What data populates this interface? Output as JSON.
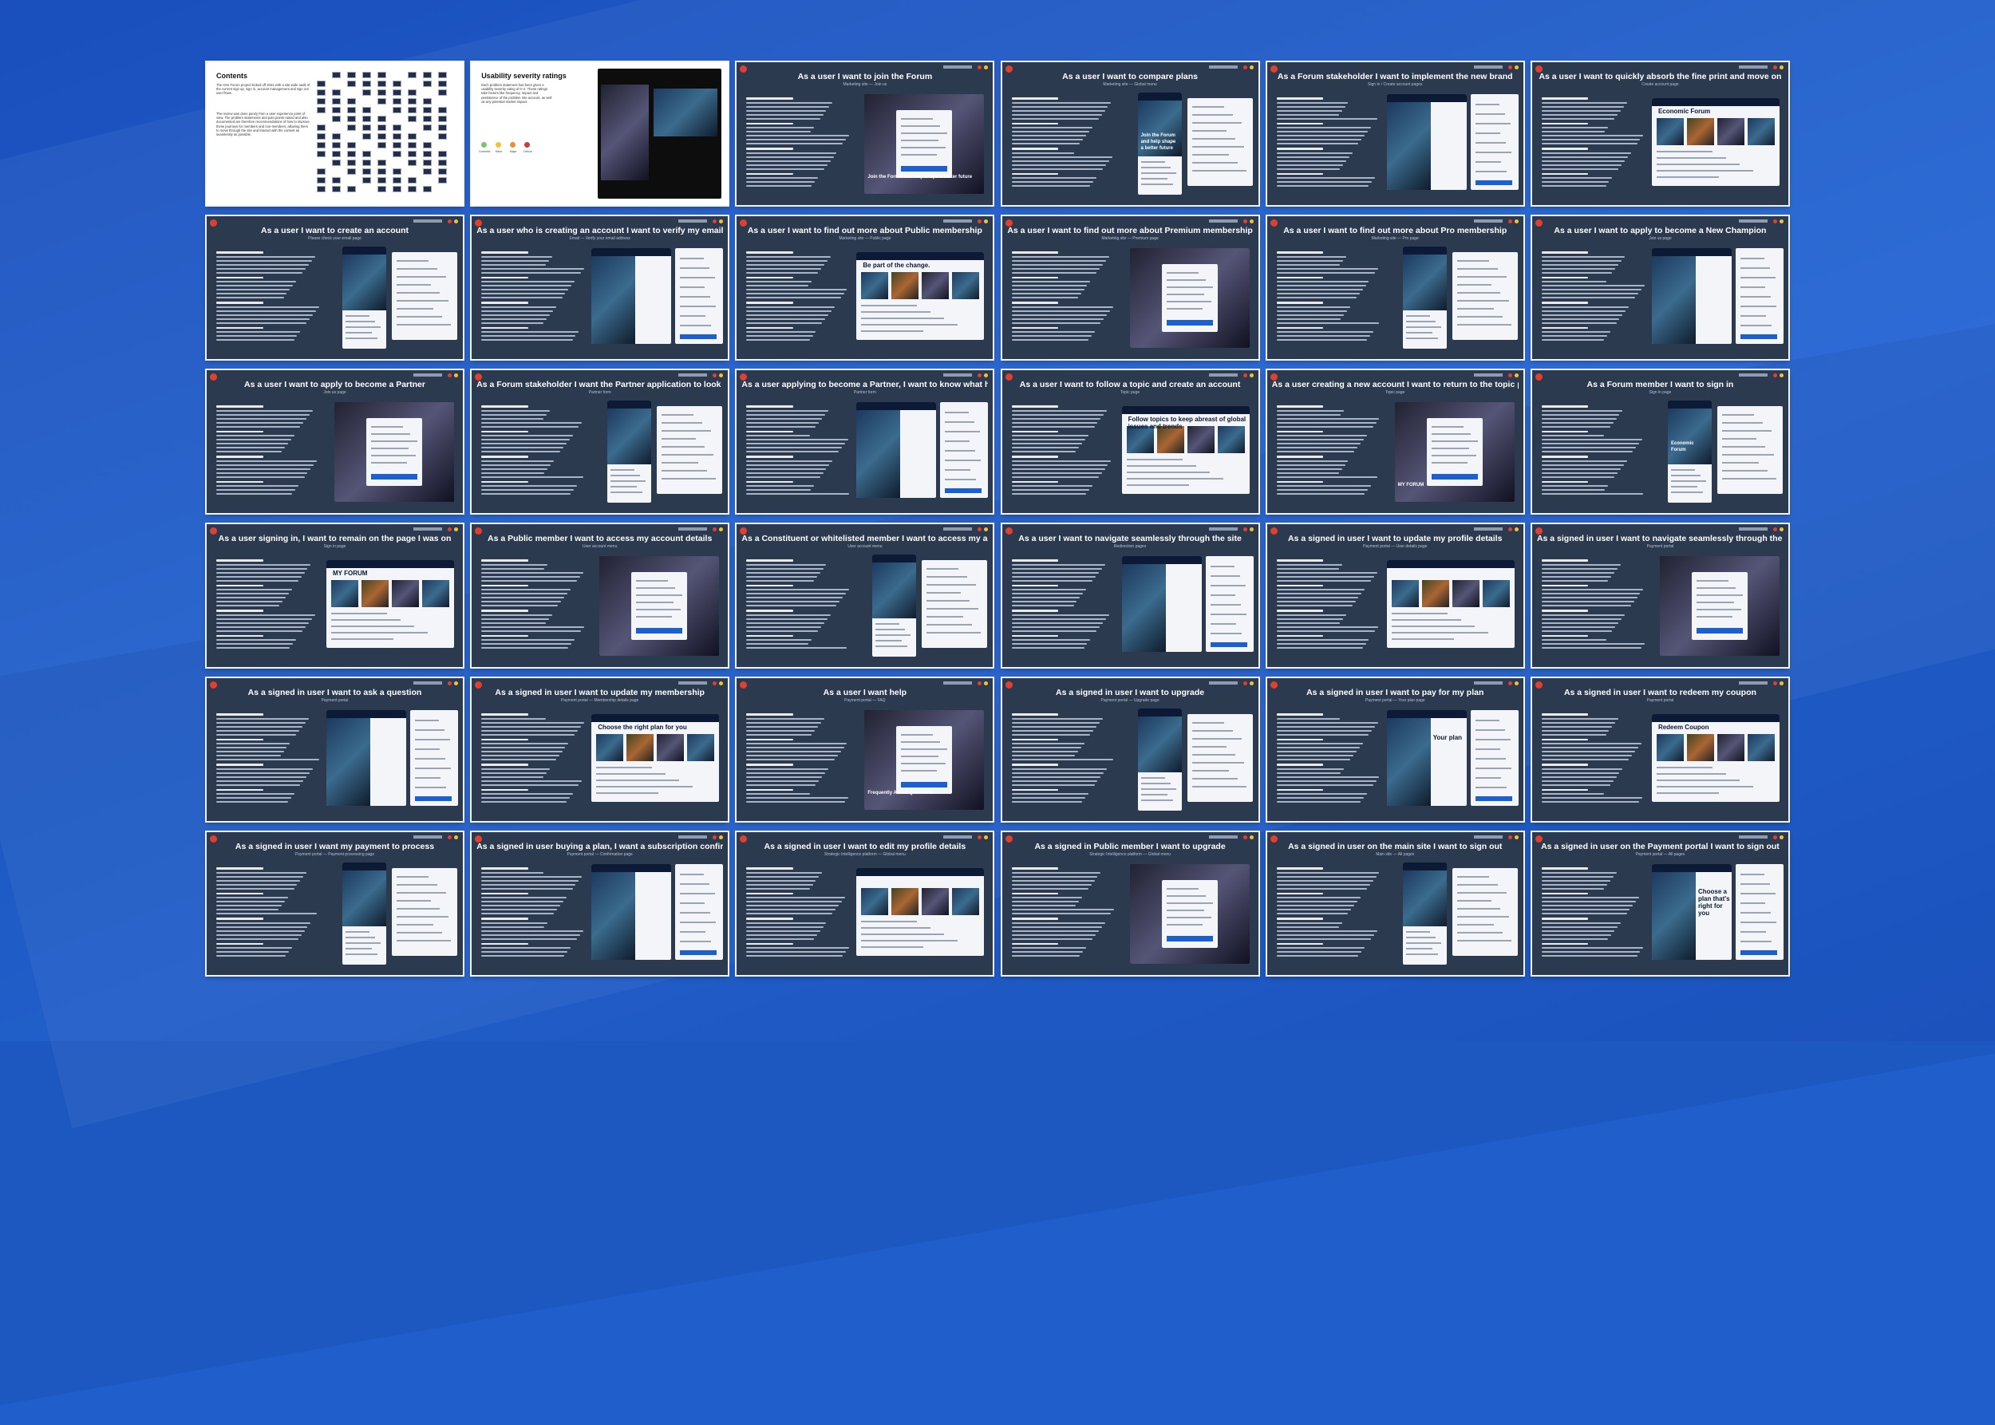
{
  "slides": [
    {
      "title": "Contents",
      "kind": "contents",
      "body": "The One Forum project kicked off 2022 with a site-wide audit of the current sign up, sign in, account management and sign out user flows.",
      "body2": "The review was done purely from a user experience point of view. The problem statements and pain points raised and also documented are therefore recommendations of how to improve these journeys for members and non-members, allowing them to move through the site and interact with the content as seamlessly as possible."
    },
    {
      "title": "Usability severity ratings",
      "kind": "severity",
      "body": "Each problem statement has been given a usability severity rating of 0–4. These ratings take factors like frequency, impact and persistence of the problem into account, as well as any potential market impact."
    },
    {
      "title": "As a user I want to join the Forum",
      "sub": "Marketing site — Join us",
      "hero": "Join the Forum and help shape a better future"
    },
    {
      "title": "As a user I want to compare plans",
      "sub": "Marketing site — Global menu",
      "hero": "Join the Forum and help shape a better future"
    },
    {
      "title": "As a Forum stakeholder I want to implement the new brand",
      "sub": "Sign in / Create account pages"
    },
    {
      "title": "As a user I want to quickly absorb the fine print and move on",
      "sub": "Create account page",
      "hero": "Economic Forum"
    },
    {
      "title": "As a user I want to create an account",
      "sub": "Please check your email page"
    },
    {
      "title": "As a user who is creating an account I want to verify my email address",
      "sub": "Email — Verify your email address"
    },
    {
      "title": "As a user I want to find out more about Public membership",
      "sub": "Marketing site — Public page",
      "hero": "Be part of the change."
    },
    {
      "title": "As a user I want to find out more about Premium membership",
      "sub": "Marketing site — Premium page"
    },
    {
      "title": "As a user I want to find out more about Pro membership",
      "sub": "Marketing site — Pro page"
    },
    {
      "title": "As a user I want to apply to become a New Champion",
      "sub": "Join us page"
    },
    {
      "title": "As a user I want to apply to become a Partner",
      "sub": "Join us page"
    },
    {
      "title": "As a Forum stakeholder I want the Partner application to look premium",
      "sub": "Partner form"
    },
    {
      "title": "As a user applying to become a Partner, I want to know what happens next",
      "sub": "Partner form"
    },
    {
      "title": "As a user I want to follow a topic and create an account",
      "sub": "Topic page",
      "hero": "Follow topics to keep abreast of global issues and trends"
    },
    {
      "title": "As a user creating a new account I want to return to the topic page",
      "sub": "Topic page",
      "hero": "MY FORUM"
    },
    {
      "title": "As a Forum member I want to sign in",
      "sub": "Sign in page",
      "hero": "Economic Forum"
    },
    {
      "title": "As a user signing in, I want to remain on the page I was on",
      "sub": "Sign in page",
      "hero": "MY FORUM"
    },
    {
      "title": "As a Public member I want to access my account details",
      "sub": "User account menu"
    },
    {
      "title": "As a Constituent or whitelisted member I want to access my account details",
      "sub": "User account menu"
    },
    {
      "title": "As a user I want to navigate seamlessly through the site",
      "sub": "Redirection pages"
    },
    {
      "title": "As a signed in user I want to update my profile details",
      "sub": "Payment portal — User details page"
    },
    {
      "title": "As a signed in user I want to navigate seamlessly through the site",
      "sub": "Payment portal"
    },
    {
      "title": "As a signed in user I want to ask a question",
      "sub": "Payment portal"
    },
    {
      "title": "As a signed in user I want to update my membership",
      "sub": "Payment portal — Membership details page",
      "hero": "Choose the right plan for you"
    },
    {
      "title": "As a user I want help",
      "sub": "Payment portal — FAQ",
      "hero": "Frequently Asked Questions"
    },
    {
      "title": "As a signed in user I want to upgrade",
      "sub": "Payment portal — Upgrade page"
    },
    {
      "title": "As a signed in user I want to pay for my plan",
      "sub": "Payment portal — Your plan page",
      "hero": "Your plan"
    },
    {
      "title": "As a signed in user I want to redeem my coupon",
      "sub": "Payment portal",
      "hero": "Redeem Coupon"
    },
    {
      "title": "As a signed in user I want my payment to process",
      "sub": "Payment portal — Payment processing page"
    },
    {
      "title": "As a signed in user buying a plan, I want a subscription confirmation",
      "sub": "Payment portal — Confirmation page"
    },
    {
      "title": "As a signed in user I want to edit my profile details",
      "sub": "Strategic Intelligence platform — Global menu"
    },
    {
      "title": "As a signed in Public member I want to upgrade",
      "sub": "Strategic Intelligence platform — Global menu"
    },
    {
      "title": "As a signed in user on the main site I want to sign out",
      "sub": "Main site — All pages"
    },
    {
      "title": "As a signed in user on the Payment portal I want to sign out",
      "sub": "Payment portal — All pages",
      "hero": "Choose a plan that's right for you"
    }
  ],
  "colors": {
    "background": "#1f5ecb",
    "slide": "#2b3a4f",
    "accent": "#1b5fd0",
    "red": "#e0402f"
  },
  "severity_labels": [
    "Cosmetic",
    "Minor",
    "Major",
    "Critical"
  ]
}
